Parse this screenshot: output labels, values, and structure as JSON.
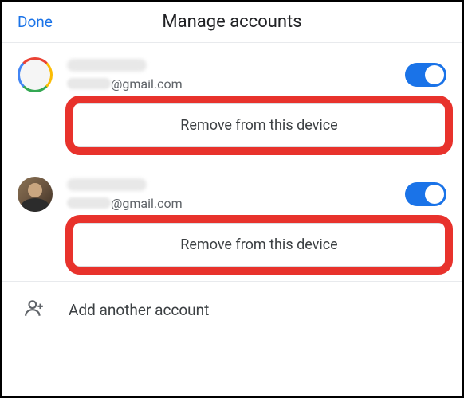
{
  "header": {
    "done_label": "Done",
    "title": "Manage accounts"
  },
  "accounts": [
    {
      "email_domain": "@gmail.com",
      "toggle_on": true,
      "remove_label": "Remove from this device"
    },
    {
      "email_domain": "@gmail.com",
      "toggle_on": true,
      "remove_label": "Remove from this device"
    }
  ],
  "add_account": {
    "label": "Add another account"
  },
  "colors": {
    "accent": "#1a73e8",
    "highlight": "#e8322c"
  }
}
